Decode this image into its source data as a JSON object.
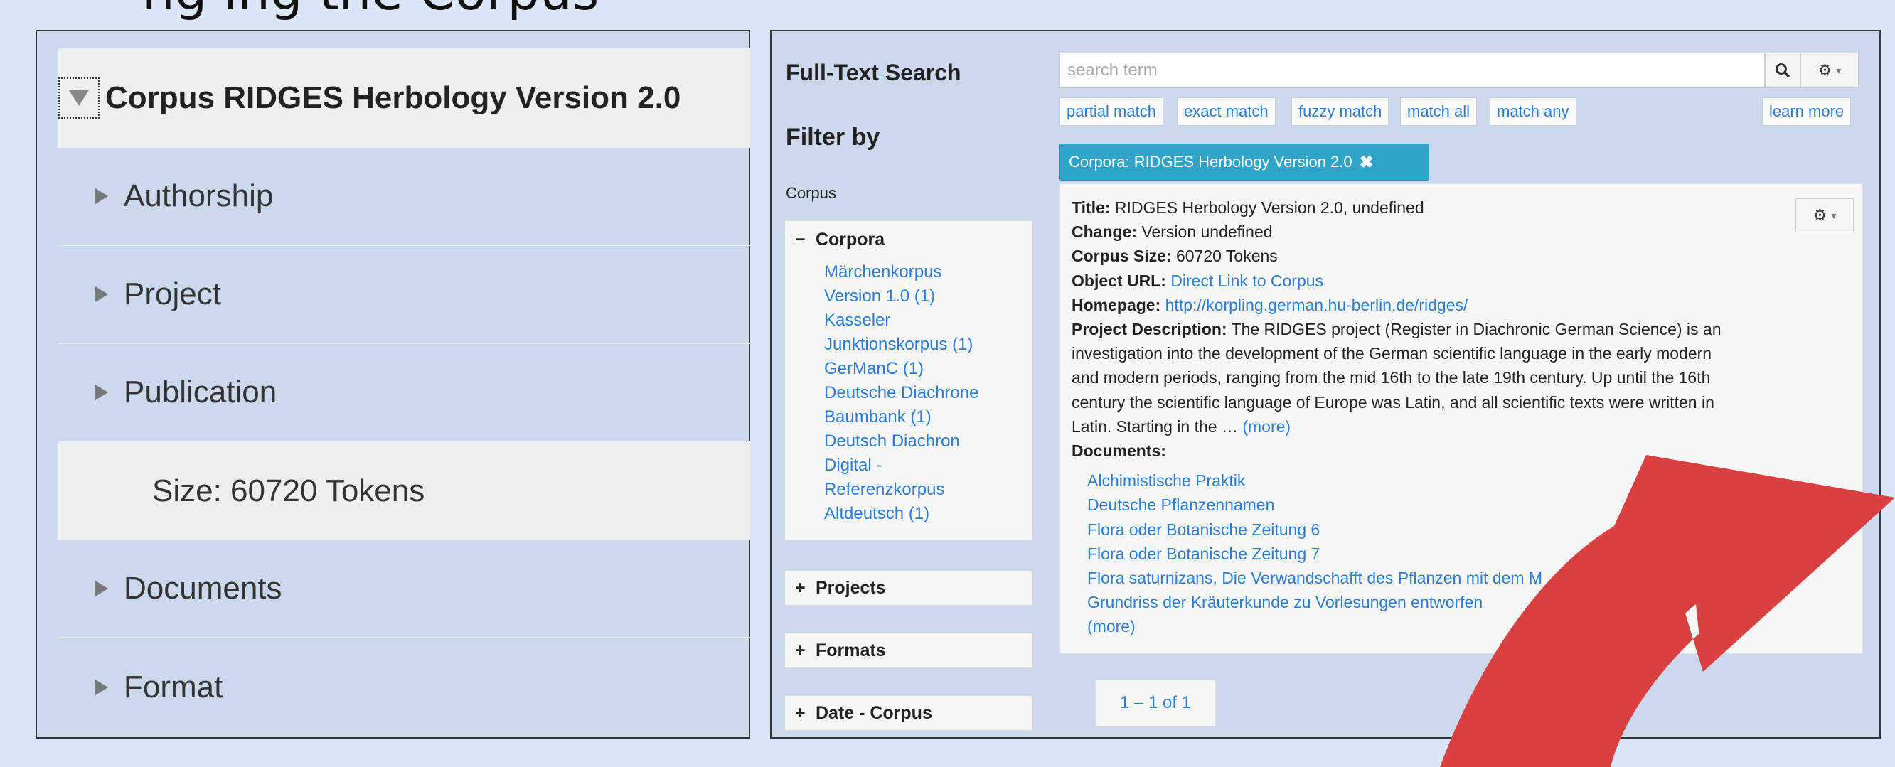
{
  "top_caption": "ng ing the Corpus",
  "tree": {
    "root": "Corpus RIDGES Herbology Version 2.0",
    "items": [
      {
        "label": "Authorship"
      },
      {
        "label": "Project"
      },
      {
        "label": "Publication"
      },
      {
        "label": "Size: 60720 Tokens"
      },
      {
        "label": "Documents"
      },
      {
        "label": "Format"
      }
    ]
  },
  "search": {
    "heading": "Full-Text Search",
    "placeholder": "search term",
    "search_icon": "search-icon",
    "settings_icon": "gear-icon",
    "match_buttons": [
      "partial match",
      "exact match",
      "fuzzy match",
      "match all",
      "match any"
    ],
    "learn_more": "learn more"
  },
  "filter": {
    "heading": "Filter by",
    "section_label": "Corpus",
    "corpora": {
      "title": "Corpora",
      "toggle": "−",
      "items": [
        "Märchenkorpus",
        "Version 1.0 (1)",
        "Kasseler",
        "Junktionskorpus (1)",
        "GerManC (1)",
        "Deutsche Diachrone",
        "Baumbank (1)",
        "Deutsch Diachron",
        "Digital -",
        "Referenzkorpus",
        "Altdeutsch (1)"
      ]
    },
    "collapsed": [
      {
        "toggle": "+",
        "title": "Projects"
      },
      {
        "toggle": "+",
        "title": "Formats"
      },
      {
        "toggle": "+",
        "title": "Date - Corpus"
      }
    ],
    "active_chip": "Corpora: RIDGES Herbology Version 2.0",
    "chip_close": "✖"
  },
  "result": {
    "title_label": "Title:",
    "title_value": "RIDGES Herbology Version 2.0, undefined",
    "change_label": "Change:",
    "change_value": "Version undefined",
    "size_label": "Corpus Size:",
    "size_value": "60720 Tokens",
    "url_label": "Object URL:",
    "url_value": "Direct Link to Corpus",
    "homepage_label": "Homepage:",
    "homepage_value": "http://korpling.german.hu-berlin.de/ridges/",
    "desc_label": "Project Description:",
    "desc_lines": [
      "The RIDGES project (Register in Diachronic German Science) is an",
      "investigation into the development of the German scientific language in the early modern",
      "and modern periods, ranging from the mid 16th to the late 19th century. Up until the 16th",
      "century the scientific language of Europe was Latin, and all scientific texts were written in",
      "Latin. Starting in the … "
    ],
    "desc_more": "(more)",
    "documents_label": "Documents:",
    "documents": [
      "Alchimistische Praktik",
      "Deutsche Pflanzennamen",
      "Flora oder Botanische Zeitung 6",
      "Flora oder Botanische Zeitung 7",
      "Flora saturnizans, Die Verwandschafft des Pflanzen mit dem M",
      "Grundriss der Kräuterkunde zu Vorlesungen entworfen"
    ],
    "documents_more": "(more)"
  },
  "pager": "1 – 1 of 1",
  "colors": {
    "background": "#dbe6f7",
    "panel": "#ccd9ed",
    "link": "#2b7cd3",
    "chip": "#2fa4c8",
    "arrow": "#d94040"
  }
}
